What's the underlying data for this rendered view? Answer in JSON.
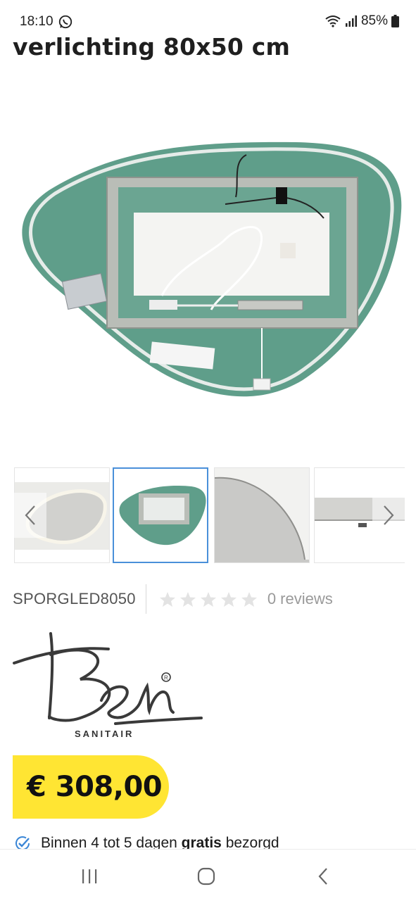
{
  "status_bar": {
    "time": "18:10",
    "battery": "85%",
    "icons": [
      "whatsapp-icon",
      "wifi-icon",
      "signal-icon",
      "battery-icon"
    ]
  },
  "product": {
    "title": "verlichting 80x50 cm",
    "sku": "SPORGLED8050",
    "rating_stars": 0,
    "reviews_label": "0 reviews",
    "price": "€ 308,00"
  },
  "gallery": {
    "thumbnail_count": 4,
    "active_index": 1,
    "icons": [
      "chevron-left-icon",
      "chevron-right-icon"
    ]
  },
  "brand": {
    "logo_name": "Ben",
    "logo_subtitle": "SANITAIR"
  },
  "delivery": {
    "prefix": "Binnen 4 tot 5 dagen ",
    "bold": "gratis",
    "suffix": " bezorgd"
  },
  "colors": {
    "price_badge": "#ffe533",
    "mirror_back": "#5f9e8a",
    "active_thumb_border": "#4a90d9",
    "check_icon": "#3a86d6"
  },
  "system_nav": {
    "icons": [
      "recents-icon",
      "home-icon",
      "back-icon"
    ]
  }
}
